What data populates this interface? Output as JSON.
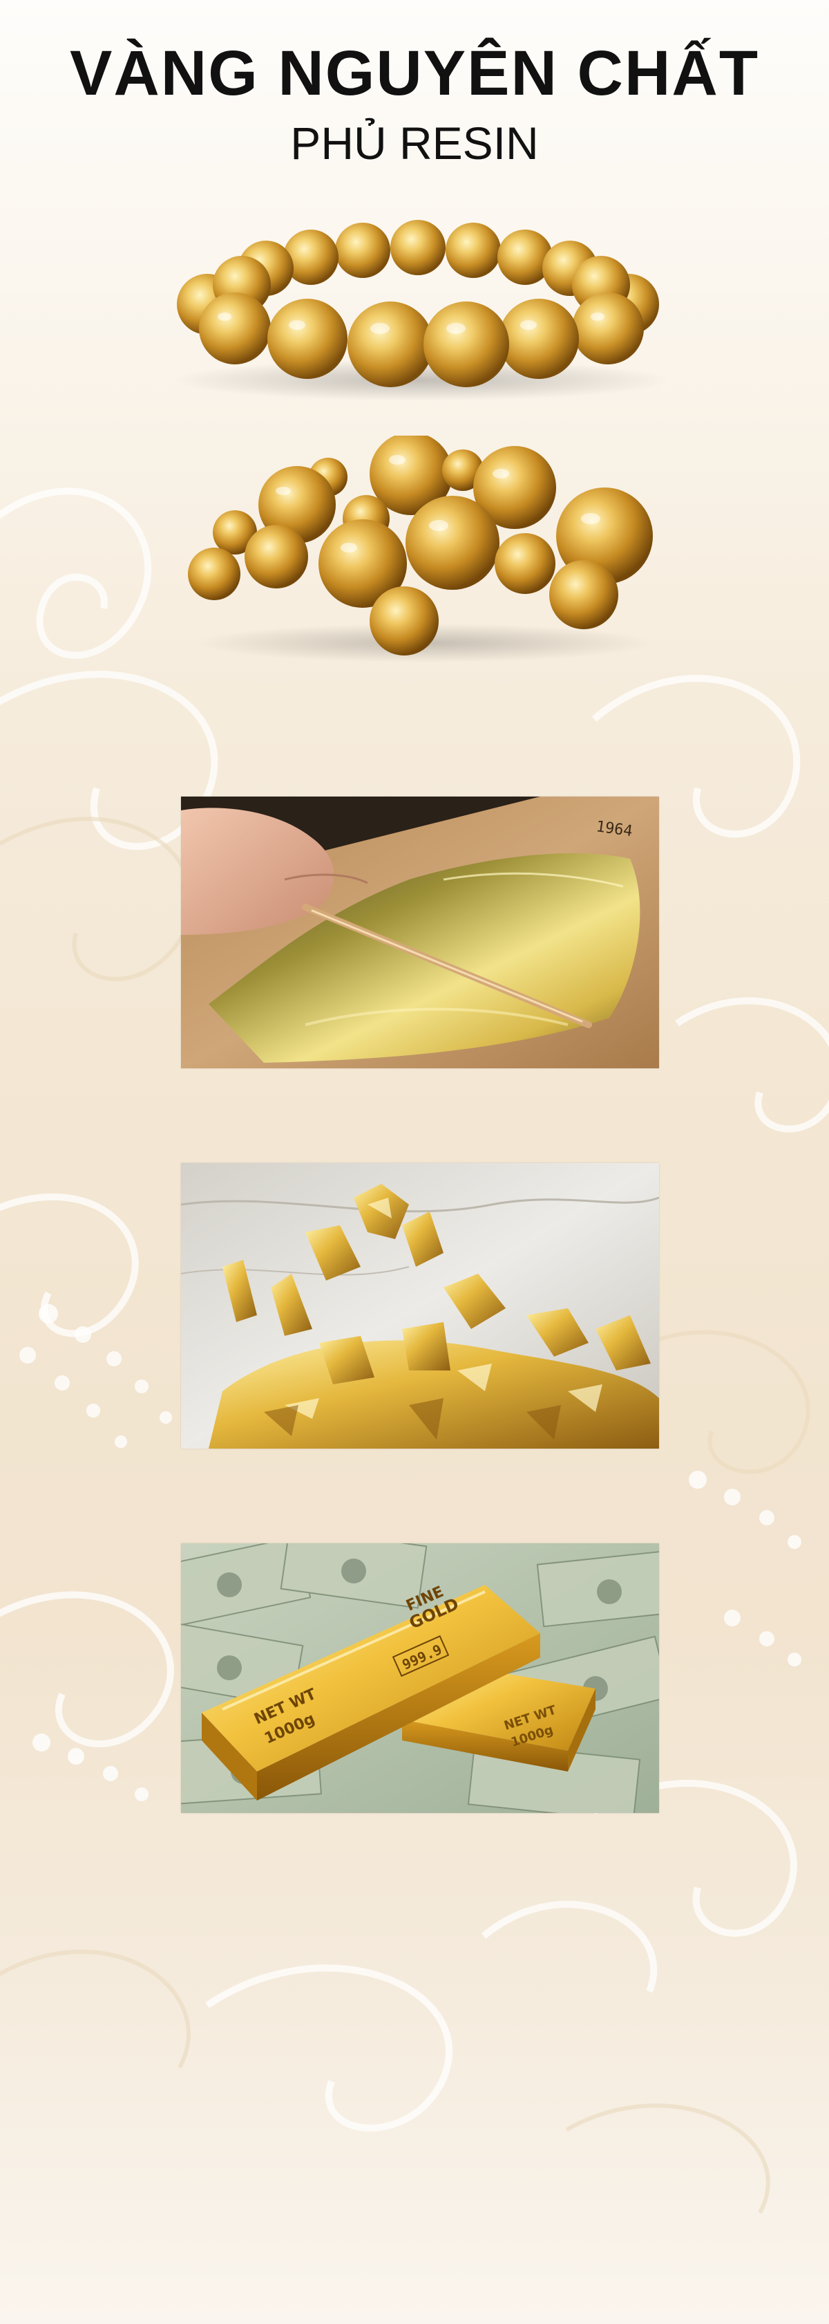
{
  "header": {
    "title": "VÀNG NGUYÊN CHẤT",
    "subtitle": "PHỦ RESIN"
  },
  "images": [
    {
      "name": "gold-bead-bracelet",
      "icon": "bracelet-photo"
    },
    {
      "name": "loose-gold-beads",
      "icon": "beads-photo"
    },
    {
      "name": "gold-leaf-sheet",
      "icon": "gold-leaf-photo"
    },
    {
      "name": "gold-flakes",
      "icon": "gold-flakes-photo"
    },
    {
      "name": "gold-bars-on-dollars",
      "icon": "gold-bars-photo"
    }
  ],
  "gold_bar": {
    "front_text_1": "FINE",
    "front_text_2": "GOLD",
    "purity": "999.9",
    "weight_label_1": "NET WT",
    "weight_label_2": "1000g"
  },
  "leaf_paper_mark": "1964",
  "colors": {
    "gold_light": "#f3d57a",
    "gold_mid": "#d9a63a",
    "gold_dark": "#9a6a14",
    "background": "#f4e8d6"
  }
}
